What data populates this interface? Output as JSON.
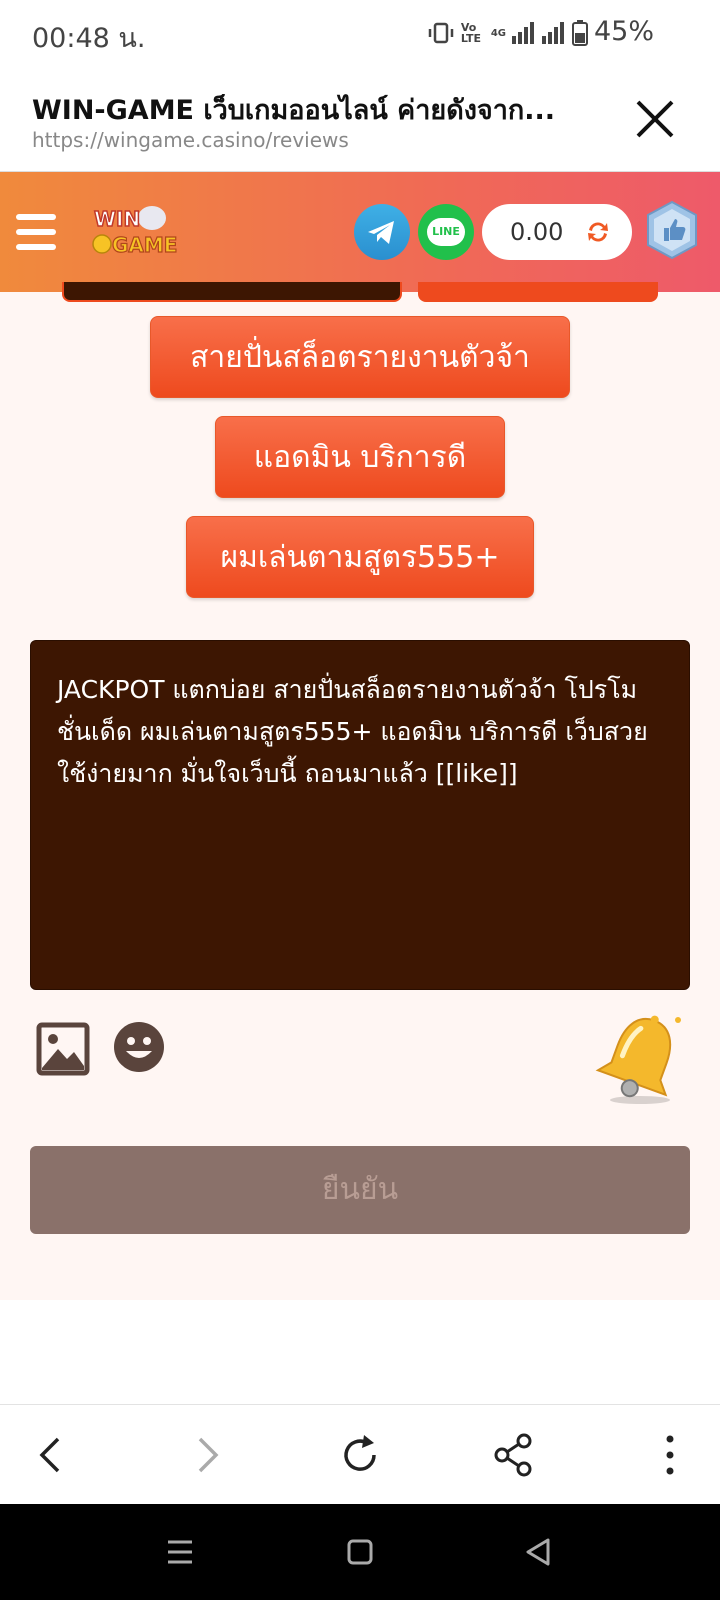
{
  "status_bar": {
    "time": "00:48 น.",
    "network": "4G",
    "volte": "Vo LTE",
    "battery": "45%"
  },
  "browser": {
    "page_title": "WIN-GAME เว็บเกมออนไลน์ ค่ายดังจาก...",
    "url": "https://wingame.casino/reviews"
  },
  "header": {
    "logo_text_top": "WIN",
    "logo_text_bottom": "GAME",
    "line_label": "LINE",
    "balance": "0.00"
  },
  "tags": [
    "สายปั่นสล็อตรายงานตัวจ้า",
    "แอดมิน บริการดี",
    "ผมเล่นตามสูตร555+"
  ],
  "review": {
    "text": "JACKPOT แตกบ่อย สายปั่นสล็อตรายงานตัวจ้า โปรโมชั่นเด็ด ผมเล่นตามสูตร555+ แอดมิน บริการดี เว็บสวย ใช้ง่ายมาก มั่นใจเว็บนี้ ถอนมาแล้ว [[like]]"
  },
  "confirm_label": "ยืนยัน",
  "colors": {
    "header_gradient_start": "#f08a3c",
    "header_gradient_end": "#ee5a6a",
    "tag_button": "#ee4a1e",
    "textarea_bg": "#3d1602",
    "confirm_bg": "#8a716a",
    "content_bg": "#fff6f3"
  }
}
